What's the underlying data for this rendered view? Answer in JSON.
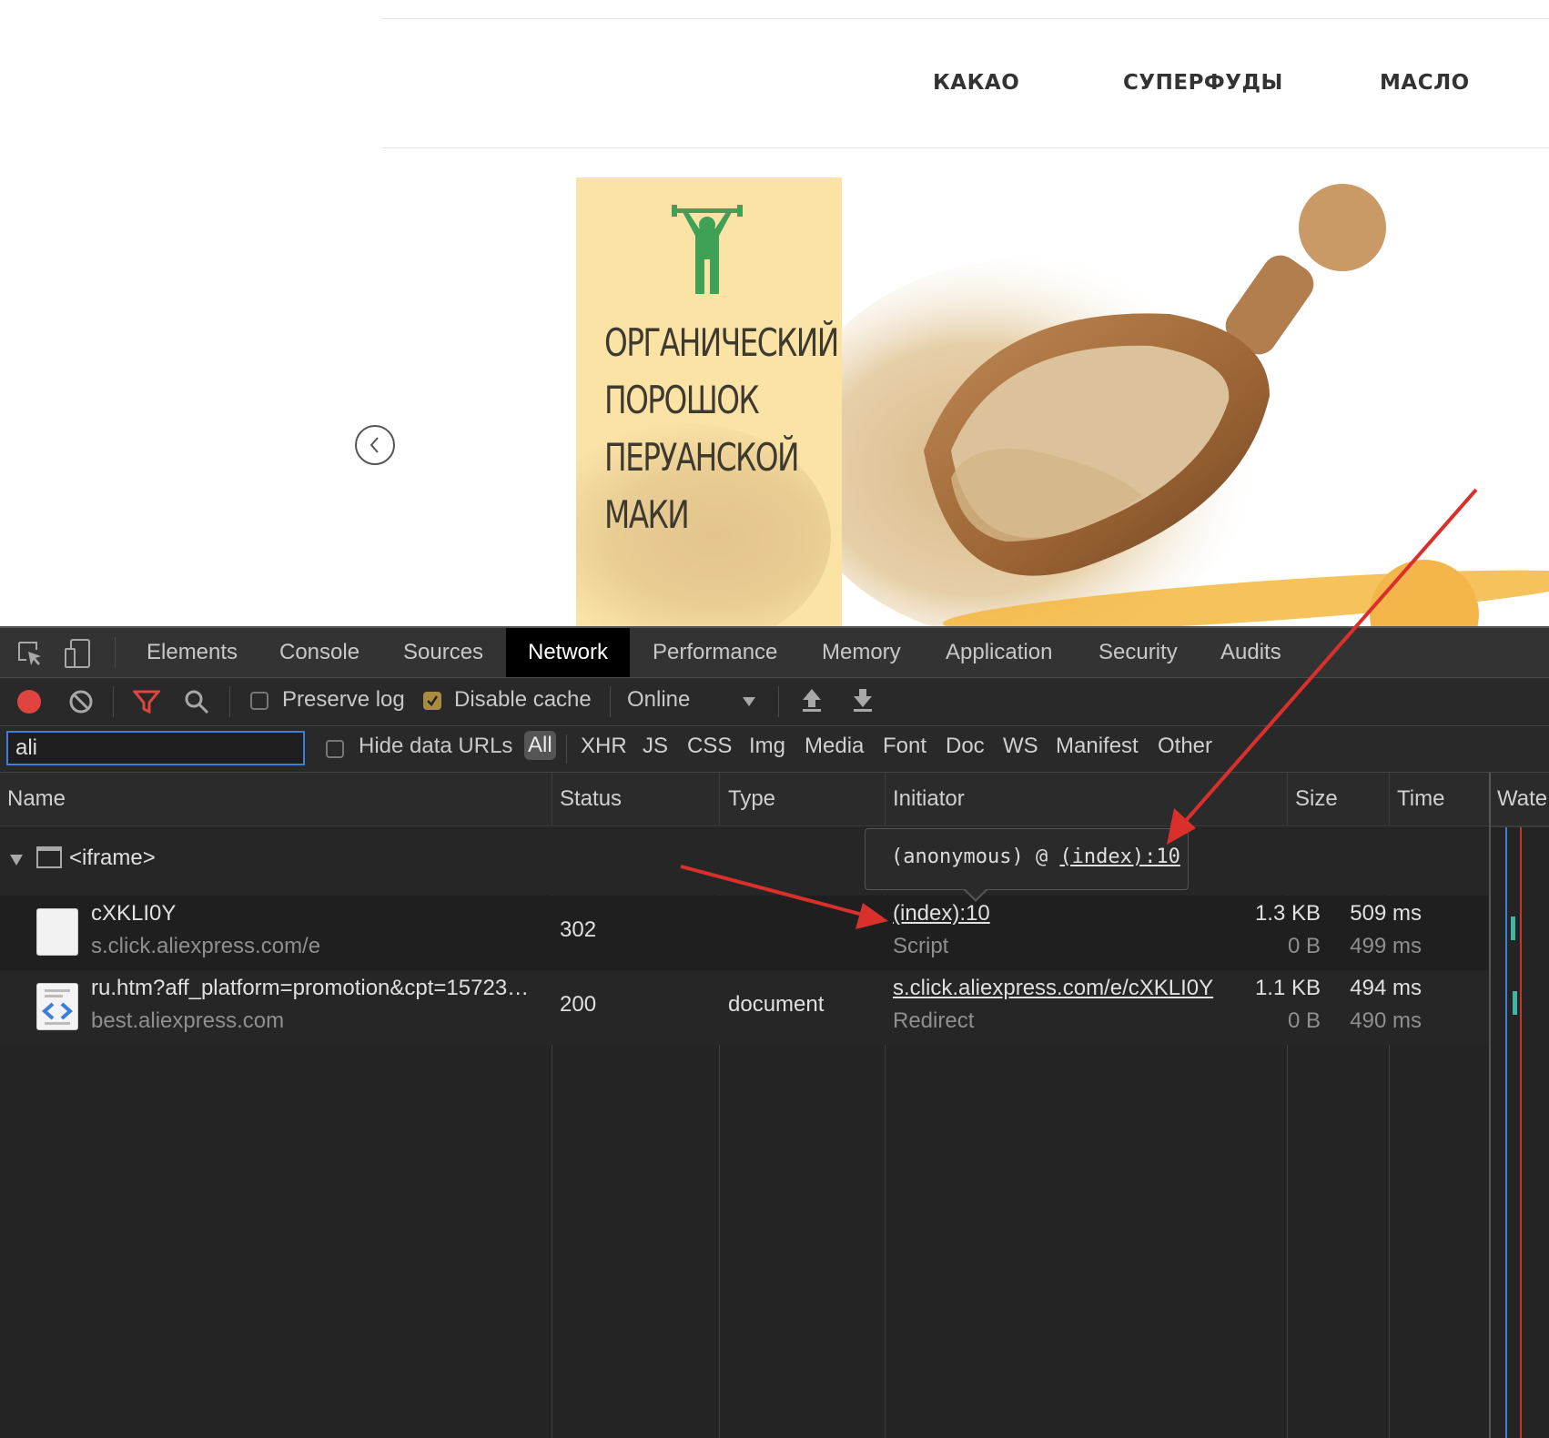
{
  "site": {
    "nav": [
      "КАКАО",
      "СУПЕРФУДЫ",
      "МАСЛО"
    ],
    "hero_title": [
      "ОРГАНИЧЕСКИЙ",
      "ПОРОШОК",
      "ПЕРУАНСКОЙ",
      "МАКИ"
    ]
  },
  "devtools": {
    "tabs": [
      "Elements",
      "Console",
      "Sources",
      "Network",
      "Performance",
      "Memory",
      "Application",
      "Security",
      "Audits"
    ],
    "active_tab": "Network",
    "toolbar": {
      "preserve_log": "Preserve log",
      "disable_cache": "Disable cache",
      "throttle": "Online"
    },
    "filter": {
      "value": "ali",
      "hide_data_urls": "Hide data URLs",
      "types": [
        "All",
        "XHR",
        "JS",
        "CSS",
        "Img",
        "Media",
        "Font",
        "Doc",
        "WS",
        "Manifest",
        "Other"
      ]
    },
    "columns": [
      "Name",
      "Status",
      "Type",
      "Initiator",
      "Size",
      "Time",
      "Wate"
    ],
    "group_label": "<iframe>",
    "requests": [
      {
        "name": "cXKLI0Y",
        "domain": "s.click.aliexpress.com/e",
        "status": "302",
        "type": "",
        "initiator": "(index):10",
        "initiator_type": "Script",
        "size": "1.3 KB",
        "size_resource": "0 B",
        "time": "509 ms",
        "latency": "499 ms"
      },
      {
        "name": "ru.htm?aff_platform=promotion&cpt=15723…",
        "domain": "best.aliexpress.com",
        "status": "200",
        "type": "document",
        "initiator": "s.click.aliexpress.com/e/cXKLI0Y",
        "initiator_type": "Redirect",
        "size": "1.1 KB",
        "size_resource": "0 B",
        "time": "494 ms",
        "latency": "490 ms"
      }
    ],
    "tooltip": {
      "prefix": "(anonymous) @ ",
      "link": "(index):10"
    }
  },
  "colors": {
    "devtools_bg": "#242424",
    "active_tab_bg": "#000000",
    "record": "#e0443e",
    "filter_icon": "#e0443e",
    "annotation_arrow": "#d9302c",
    "checkbox_checked": "#a98c3f",
    "hero_yellow": "#fbe3a6",
    "athlete_green": "#3fa156"
  },
  "icons": [
    "inspect-element-icon",
    "device-toolbar-icon",
    "record-icon",
    "clear-icon",
    "filter-icon",
    "search-icon",
    "dropdown-arrow-icon",
    "import-har-icon",
    "export-har-icon",
    "frame-icon",
    "document-icon",
    "slider-prev-icon",
    "athlete-icon"
  ]
}
